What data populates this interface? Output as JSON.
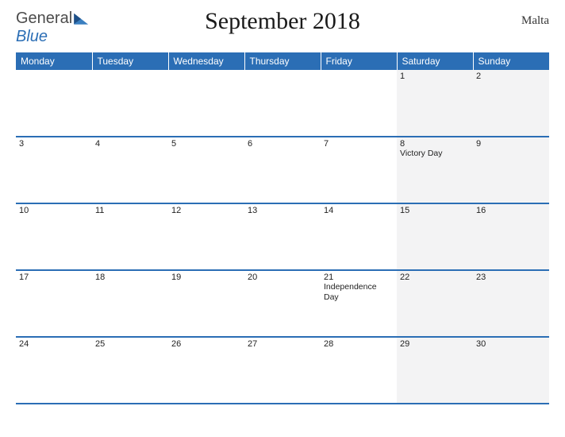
{
  "brand": {
    "part1": "General",
    "part2": "Blue"
  },
  "title": "September 2018",
  "region": "Malta",
  "weekdays": [
    "Monday",
    "Tuesday",
    "Wednesday",
    "Thursday",
    "Friday",
    "Saturday",
    "Sunday"
  ],
  "weeks": [
    [
      {
        "day": "",
        "weekend": false
      },
      {
        "day": "",
        "weekend": false
      },
      {
        "day": "",
        "weekend": false
      },
      {
        "day": "",
        "weekend": false
      },
      {
        "day": "",
        "weekend": false
      },
      {
        "day": "1",
        "weekend": true
      },
      {
        "day": "2",
        "weekend": true
      }
    ],
    [
      {
        "day": "3",
        "weekend": false
      },
      {
        "day": "4",
        "weekend": false
      },
      {
        "day": "5",
        "weekend": false
      },
      {
        "day": "6",
        "weekend": false
      },
      {
        "day": "7",
        "weekend": false
      },
      {
        "day": "8",
        "weekend": true,
        "event": "Victory Day"
      },
      {
        "day": "9",
        "weekend": true
      }
    ],
    [
      {
        "day": "10",
        "weekend": false
      },
      {
        "day": "11",
        "weekend": false
      },
      {
        "day": "12",
        "weekend": false
      },
      {
        "day": "13",
        "weekend": false
      },
      {
        "day": "14",
        "weekend": false
      },
      {
        "day": "15",
        "weekend": true
      },
      {
        "day": "16",
        "weekend": true
      }
    ],
    [
      {
        "day": "17",
        "weekend": false
      },
      {
        "day": "18",
        "weekend": false
      },
      {
        "day": "19",
        "weekend": false
      },
      {
        "day": "20",
        "weekend": false
      },
      {
        "day": "21",
        "weekend": false,
        "event": "Independence Day"
      },
      {
        "day": "22",
        "weekend": true
      },
      {
        "day": "23",
        "weekend": true
      }
    ],
    [
      {
        "day": "24",
        "weekend": false
      },
      {
        "day": "25",
        "weekend": false
      },
      {
        "day": "26",
        "weekend": false
      },
      {
        "day": "27",
        "weekend": false
      },
      {
        "day": "28",
        "weekend": false
      },
      {
        "day": "29",
        "weekend": true
      },
      {
        "day": "30",
        "weekend": true
      }
    ]
  ]
}
